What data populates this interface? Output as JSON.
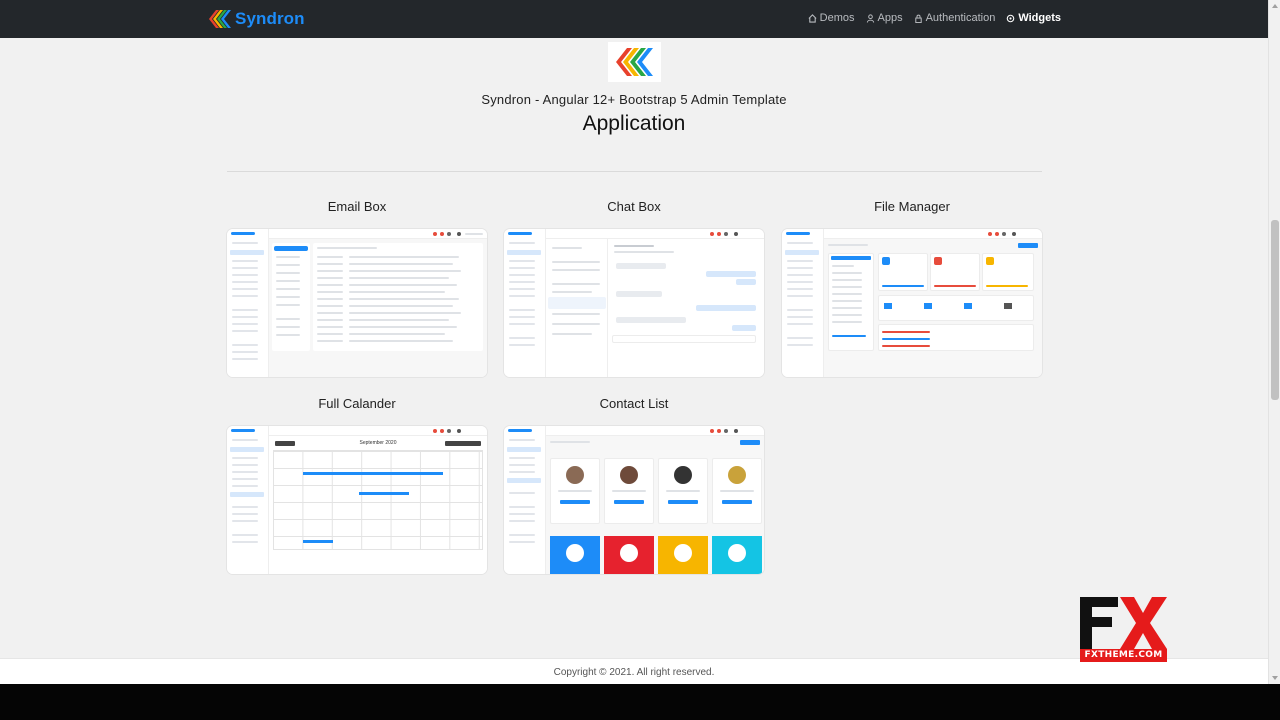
{
  "navbar": {
    "brand": "Syndron",
    "items": [
      {
        "label": "Demos",
        "icon": "home-icon",
        "active": false
      },
      {
        "label": "Apps",
        "icon": "user-icon",
        "active": false
      },
      {
        "label": "Authentication",
        "icon": "lock-icon",
        "active": false
      },
      {
        "label": "Widgets",
        "icon": "widgets-icon",
        "active": true
      }
    ]
  },
  "hero": {
    "subtitle": "Syndron - Angular 12+ Bootstrap 5 Admin Template",
    "title": "Application"
  },
  "cards": [
    {
      "title": "Email Box"
    },
    {
      "title": "Chat Box"
    },
    {
      "title": "File Manager"
    },
    {
      "title": "Full Calander"
    },
    {
      "title": "Contact List"
    }
  ],
  "thumbnail_text": {
    "calendar_month": "September 2020"
  },
  "footer": {
    "copyright": "Copyright © 2021. All right reserved."
  },
  "watermark": {
    "caption": "FXTHEME.COM"
  },
  "colors": {
    "navbar_bg": "#23272b",
    "brand_blue": "#1d8cf8",
    "page_bg": "#f1f1f1",
    "watermark_red": "#e51b1b"
  }
}
